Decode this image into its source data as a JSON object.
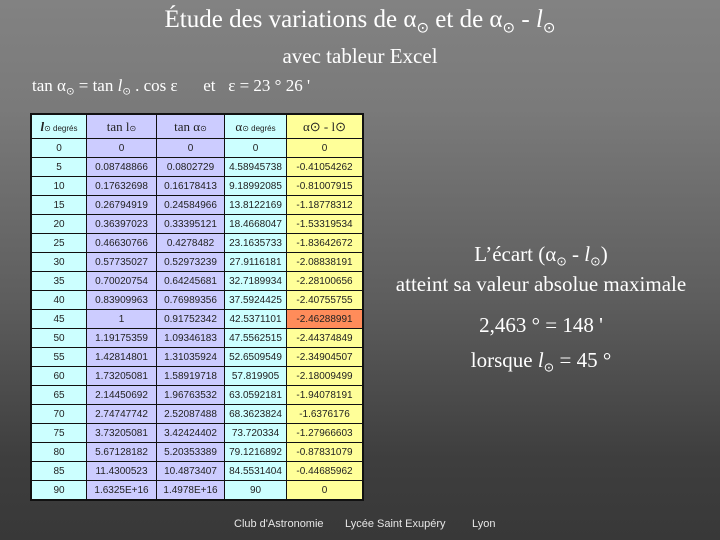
{
  "title": {
    "prefix": "Étude des variations de ",
    "alpha": "α",
    "sun": "⊙",
    "mid": " et de ",
    "dash": " - ",
    "l": "l"
  },
  "subtitle": "avec tableur Excel",
  "formula": {
    "lhs": "tan α",
    "sun": "⊙",
    "eq": " = tan ",
    "l": "l",
    "rest": " . cos ε",
    "and": "et   ε = 23 ° 26 '"
  },
  "table": {
    "headers": [
      {
        "main": "l",
        "sub": "⊙ degrés"
      },
      {
        "main": "tan l",
        "sub": "⊙"
      },
      {
        "main": "tan α",
        "sub": "⊙"
      },
      {
        "main": "α",
        "sub": "⊙ degrés"
      },
      {
        "main": "α⊙ - l⊙",
        "sub": ""
      }
    ],
    "rows": [
      [
        "0",
        "0",
        "0",
        "0",
        "0"
      ],
      [
        "5",
        "0.08748866",
        "0.0802729",
        "4.58945738",
        "-0.41054262"
      ],
      [
        "10",
        "0.17632698",
        "0.16178413",
        "9.18992085",
        "-0.81007915"
      ],
      [
        "15",
        "0.26794919",
        "0.24584966",
        "13.8122169",
        "-1.18778312"
      ],
      [
        "20",
        "0.36397023",
        "0.33395121",
        "18.4668047",
        "-1.53319534"
      ],
      [
        "25",
        "0.46630766",
        "0.4278482",
        "23.1635733",
        "-1.83642672"
      ],
      [
        "30",
        "0.57735027",
        "0.52973239",
        "27.9116181",
        "-2.08838191"
      ],
      [
        "35",
        "0.70020754",
        "0.64245681",
        "32.7189934",
        "-2.28100656"
      ],
      [
        "40",
        "0.83909963",
        "0.76989356",
        "37.5924425",
        "-2.40755755"
      ],
      [
        "45",
        "1",
        "0.91752342",
        "42.5371101",
        "-2.46288991"
      ],
      [
        "50",
        "1.19175359",
        "1.09346183",
        "47.5562515",
        "-2.44374849"
      ],
      [
        "55",
        "1.42814801",
        "1.31035924",
        "52.6509549",
        "-2.34904507"
      ],
      [
        "60",
        "1.73205081",
        "1.58919718",
        "57.819905",
        "-2.18009499"
      ],
      [
        "65",
        "2.14450692",
        "1.96763532",
        "63.0592181",
        "-1.94078191"
      ],
      [
        "70",
        "2.74747742",
        "2.52087488",
        "68.3623824",
        "-1.6376176"
      ],
      [
        "75",
        "3.73205081",
        "3.42424402",
        "73.720334",
        "-1.27966603"
      ],
      [
        "80",
        "5.67128182",
        "5.20353389",
        "79.1216892",
        "-0.87831079"
      ],
      [
        "85",
        "11.4300523",
        "10.4873407",
        "84.5531404",
        "-0.44685962"
      ],
      [
        "90",
        "1.6325E+16",
        "1.4978E+16",
        "90",
        "0"
      ]
    ],
    "highlight_row": 9,
    "colors": {
      "col_cyan": "#ccffff",
      "col_lavender": "#ccccff",
      "col_yellow": "#ffff99",
      "highlight": "#ff8c5a"
    }
  },
  "notes": {
    "line1_a": "L’écart  (α",
    "line1_b": " - ",
    "line1_c": ")",
    "line2": "atteint sa valeur absolue maximale",
    "line3": "2,463 ° = 148 '",
    "line4_a": "lorsque ",
    "line4_b": " = 45 °"
  },
  "footer": {
    "club": "Club d'Astronomie",
    "school": "Lycée Saint Exupéry",
    "city": "Lyon"
  }
}
